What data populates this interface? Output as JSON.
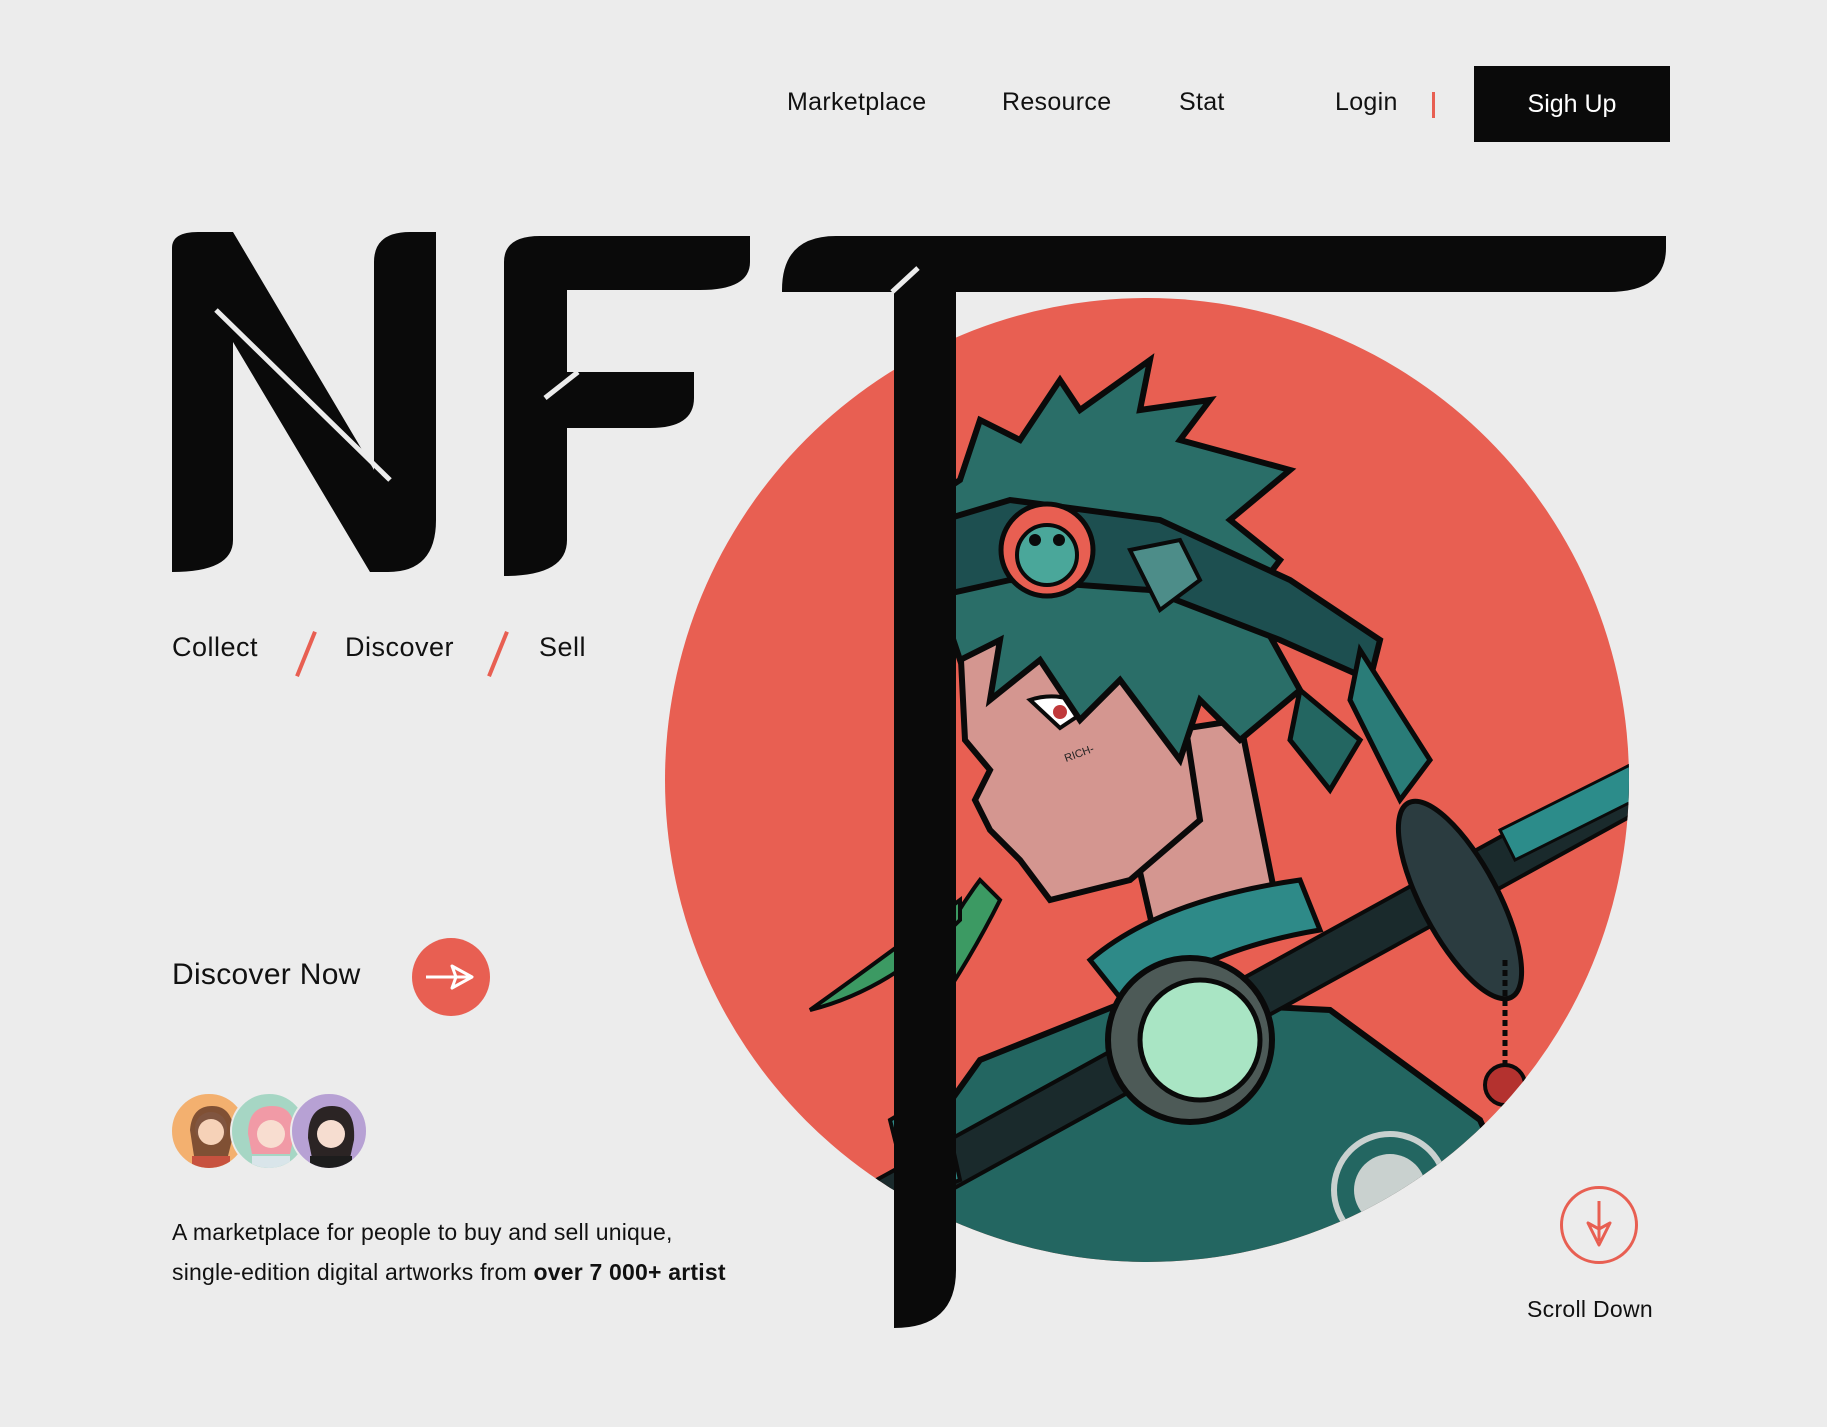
{
  "nav": {
    "items": [
      {
        "label": "Marketplace"
      },
      {
        "label": "Resource"
      },
      {
        "label": "Stat"
      }
    ],
    "login_label": "Login",
    "signup_label": "Sigh Up"
  },
  "hero": {
    "title": "NFT",
    "tagline": [
      "Collect",
      "Discover",
      "Sell"
    ],
    "cta_label": "Discover Now",
    "description_prefix": "A marketplace for people to buy and sell unique, single-edition digital artworks from ",
    "description_bold": "over 7 000+ artist",
    "scroll_label": "Scroll Down",
    "artwork_text": "RICH-"
  },
  "colors": {
    "accent": "#e85f52",
    "background": "#ececec",
    "ink": "#0a0a0a",
    "teal": "#236661"
  },
  "icons": {
    "cta": "arrow-right-icon",
    "scroll": "arrow-down-icon"
  }
}
